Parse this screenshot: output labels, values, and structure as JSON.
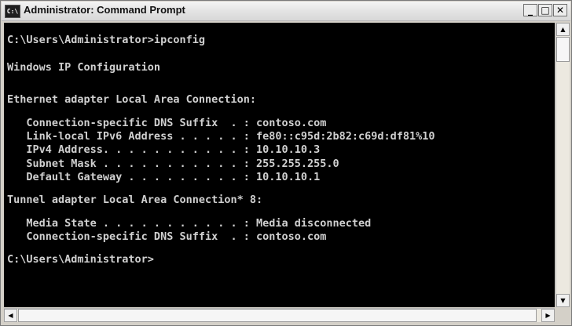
{
  "window": {
    "title": "Administrator: Command Prompt",
    "icon_text": "C:\\",
    "controls": {
      "minimize": "_",
      "maximize": "□",
      "close": "✕"
    }
  },
  "console": {
    "lines": [
      "",
      "C:\\Users\\Administrator>ipconfig",
      "",
      "Windows IP Configuration",
      "",
      "",
      "Ethernet adapter Local Area Connection:",
      "",
      "   Connection-specific DNS Suffix  . : contoso.com",
      "   Link-local IPv6 Address . . . . . : fe80::c95d:2b82:c69d:df81%10",
      "   IPv4 Address. . . . . . . . . . . : 10.10.10.3",
      "   Subnet Mask . . . . . . . . . . . : 255.255.255.0",
      "   Default Gateway . . . . . . . . . : 10.10.10.1",
      "",
      "Tunnel adapter Local Area Connection* 8:",
      "",
      "   Media State . . . . . . . . . . . : Media disconnected",
      "   Connection-specific DNS Suffix  . : contoso.com",
      "",
      "C:\\Users\\Administrator>"
    ]
  },
  "scrollbars": {
    "up_arrow": "▲",
    "down_arrow": "▼",
    "left_arrow": "◀",
    "right_arrow": "▶"
  }
}
